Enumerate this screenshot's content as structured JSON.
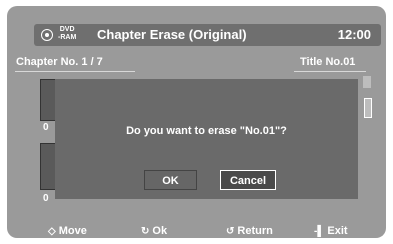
{
  "header": {
    "dvd_line1": "DVD",
    "dvd_line2": "-RAM",
    "title": "Chapter Erase (Original)",
    "clock": "12:00"
  },
  "subheader": {
    "chapter": "Chapter No. 1 / 7",
    "title_no": "Title No.01"
  },
  "thumbnails": [
    {
      "num": "0"
    },
    {
      "num": "0"
    }
  ],
  "dialog": {
    "question": "Do you want to erase \"No.01\"?",
    "ok_label": "OK",
    "cancel_label": "Cancel"
  },
  "footer": {
    "move_icon": "◇",
    "move": "Move",
    "ok_icon": "↻",
    "ok": "Ok",
    "return_icon": "↺",
    "return": "Return",
    "exit_icon": "-▌",
    "exit": "Exit"
  }
}
